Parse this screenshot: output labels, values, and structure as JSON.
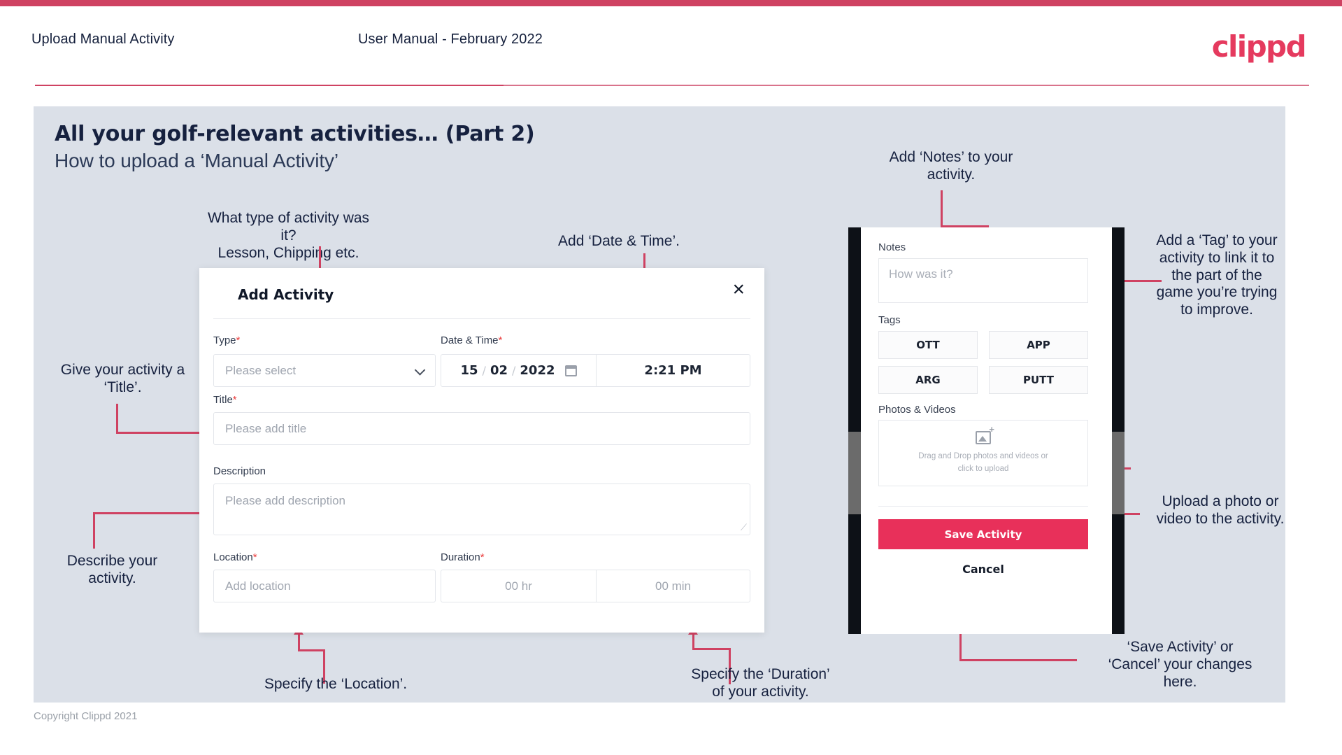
{
  "header": {
    "left_title": "Upload Manual Activity",
    "center_title": "User Manual - February 2022",
    "logo": "clippd"
  },
  "slide": {
    "title": "All your golf-relevant activities… (Part 2)",
    "subtitle": "How to upload a ‘Manual Activity’"
  },
  "annotations": {
    "type": "What type of activity was it?\nLesson, Chipping etc.",
    "datetime": "Add ‘Date & Time’.",
    "notes": "Add ‘Notes’ to your\nactivity.",
    "tag": "Add a ‘Tag’ to your\nactivity to link it to\nthe part of the\ngame you’re trying\nto improve.",
    "title_field": "Give your activity a\n‘Title’.",
    "description": "Describe your\nactivity.",
    "location": "Specify the ‘Location’.",
    "duration": "Specify the ‘Duration’\nof your activity.",
    "upload": "Upload a photo or\nvideo to the activity.",
    "save_cancel": "‘Save Activity’ or\n‘Cancel’ your changes\nhere."
  },
  "dialog": {
    "title": "Add Activity",
    "close_icon": "×",
    "fields": {
      "type_label": "Type",
      "type_placeholder": "Please select",
      "datetime_label": "Date & Time",
      "date_day": "15",
      "date_month": "02",
      "date_year": "2022",
      "date_sep": "/",
      "time_value": "2:21 PM",
      "title_label": "Title",
      "title_placeholder": "Please add title",
      "description_label": "Description",
      "description_placeholder": "Please add description",
      "location_label": "Location",
      "location_placeholder": "Add location",
      "duration_label": "Duration",
      "duration_hr_placeholder": "00 hr",
      "duration_min_placeholder": "00 min"
    },
    "required_marker": "*"
  },
  "phone": {
    "notes_label": "Notes",
    "notes_placeholder": "How was it?",
    "tags_label": "Tags",
    "tags": [
      "OTT",
      "APP",
      "ARG",
      "PUTT"
    ],
    "photos_label": "Photos & Videos",
    "dropzone_line1": "Drag and Drop photos and videos or",
    "dropzone_line2": "click to upload",
    "save_label": "Save Activity",
    "cancel_label": "Cancel"
  },
  "footer": {
    "copyright": "Copyright Clippd 2021"
  },
  "colors": {
    "accent_pink": "#cf4262",
    "save_pink": "#e8305a",
    "logo_pink": "#e53a5e",
    "slide_bg": "#dbe0e8",
    "text_dark": "#16213f"
  }
}
